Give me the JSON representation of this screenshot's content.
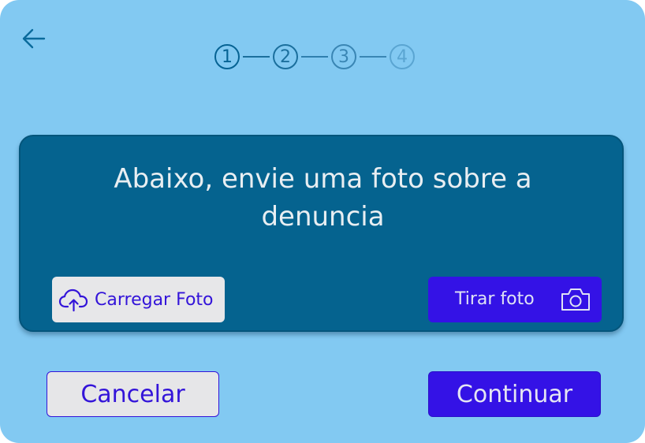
{
  "header": {
    "back_icon": "arrow-left-icon",
    "steps": [
      {
        "label": "1",
        "state": "current"
      },
      {
        "label": "2",
        "state": "upcoming"
      },
      {
        "label": "3",
        "state": "upcoming"
      },
      {
        "label": "4",
        "state": "disabled"
      }
    ]
  },
  "card": {
    "title": "Abaixo, envie uma foto sobre a denuncia",
    "upload_label": "Carregar Foto",
    "upload_icon": "cloud-upload-icon",
    "camera_label": "Tirar foto",
    "camera_icon": "camera-icon"
  },
  "footer": {
    "cancel_label": "Cancelar",
    "continue_label": "Continuar"
  },
  "colors": {
    "background": "#82c9f2",
    "card": "#05638f",
    "primary": "#3412e6",
    "secondary": "#e7e7e9",
    "step_accent": "#066394"
  }
}
